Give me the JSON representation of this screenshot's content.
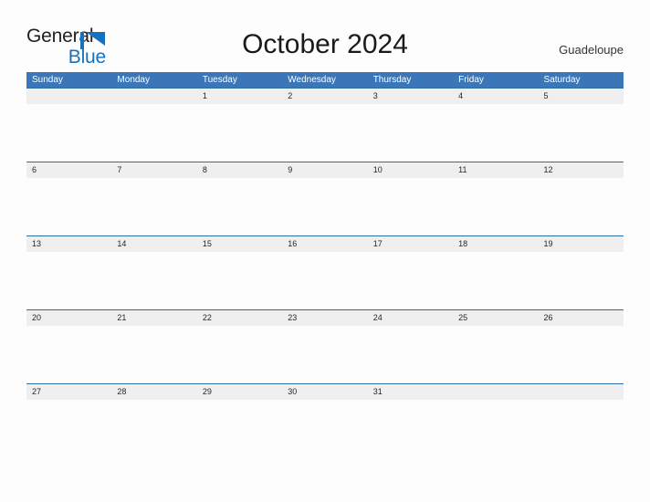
{
  "brand": {
    "name_top": "General",
    "name_bottom": "Blue",
    "mark_icon": "blue-flag-triangle-icon",
    "color_primary": "#1570be",
    "color_text": "#231f20"
  },
  "header": {
    "title": "October 2024",
    "region": "Guadeloupe"
  },
  "colors": {
    "weekday_header_bg": "#3a76b8",
    "weekday_header_text": "#ffffff",
    "date_band_bg": "#efefef",
    "date_band_border": "#2e6da4",
    "page_bg": "#fdfdfd"
  },
  "calendar": {
    "month": "October",
    "year": "2024",
    "weekdays": [
      "Sunday",
      "Monday",
      "Tuesday",
      "Wednesday",
      "Thursday",
      "Friday",
      "Saturday"
    ],
    "weeks": [
      [
        "",
        "",
        "1",
        "2",
        "3",
        "4",
        "5"
      ],
      [
        "6",
        "7",
        "8",
        "9",
        "10",
        "11",
        "12"
      ],
      [
        "13",
        "14",
        "15",
        "16",
        "17",
        "18",
        "19"
      ],
      [
        "20",
        "21",
        "22",
        "23",
        "24",
        "25",
        "26"
      ],
      [
        "27",
        "28",
        "29",
        "30",
        "31",
        "",
        ""
      ]
    ]
  }
}
